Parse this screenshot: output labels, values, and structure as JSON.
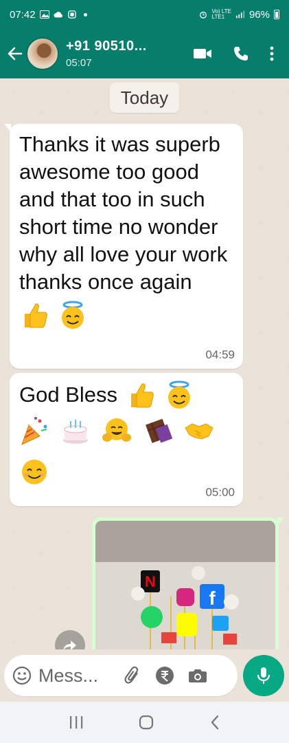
{
  "status_bar": {
    "time": "07:42",
    "network": "Vo) LTE\nLTE1",
    "battery": "96%"
  },
  "header": {
    "contact_name": "+91 90510...",
    "last_seen": "05:07"
  },
  "chat": {
    "date_label": "Today",
    "messages": [
      {
        "text": "Thanks it was superb awesome too good and that too in such short time no wonder why all love your work thanks once again",
        "emojis": [
          "thumbs-up",
          "smiling-face-with-halo"
        ],
        "time": "04:59"
      },
      {
        "text": "God Bless",
        "emojis": [
          "thumbs-up",
          "smiling-face-with-halo",
          "party-popper",
          "birthday-cake",
          "hugging-face",
          "chocolate-bar",
          "handshake",
          "smiling-face-with-smiling-eyes"
        ],
        "time": "05:00"
      }
    ]
  },
  "input": {
    "placeholder": "Mess..."
  },
  "colors": {
    "header_bg": "#077d6c",
    "accent": "#07a884",
    "chat_bg": "#ebe3d9",
    "outgoing_bubble": "#d9fdd3"
  }
}
